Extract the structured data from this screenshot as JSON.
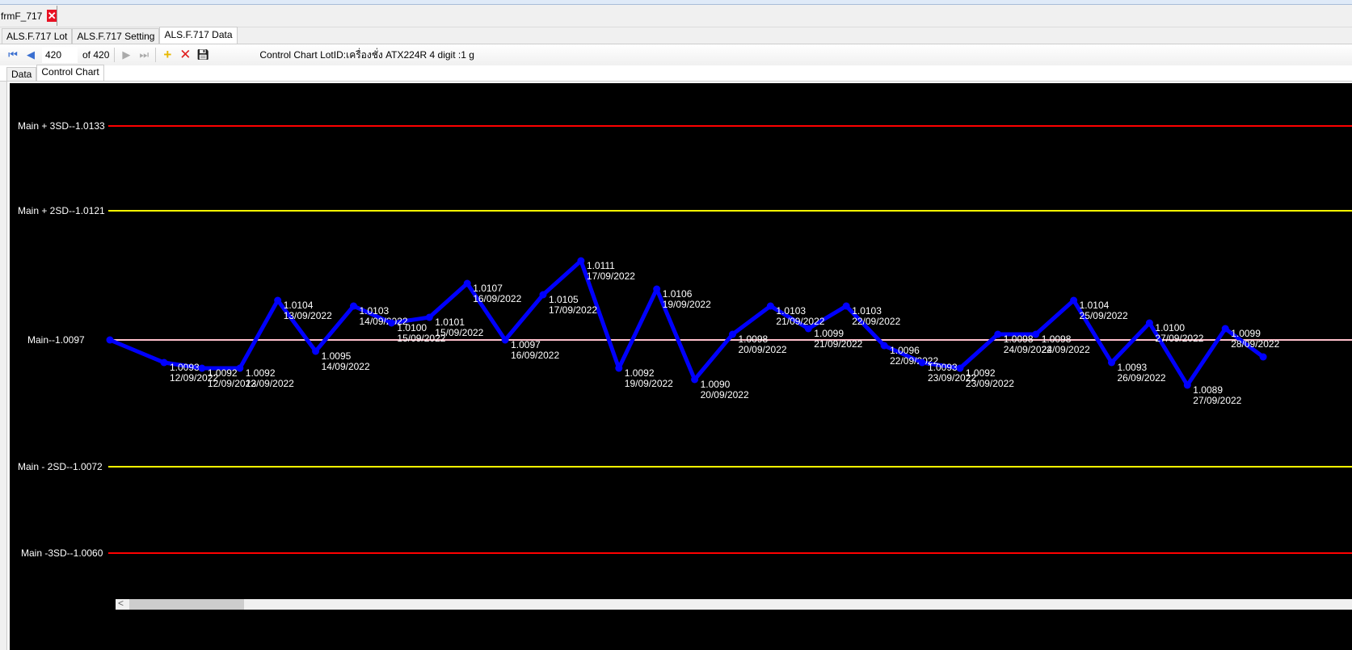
{
  "window": {
    "doc_tab": "frmF_717"
  },
  "tabs": [
    {
      "label": "ALS.F.717 Lot"
    },
    {
      "label": "ALS.F.717 Setting"
    },
    {
      "label": "ALS.F.717 Data"
    }
  ],
  "toolbar": {
    "position": "420",
    "of_label": "of 420",
    "title": "Control Chart LotID:เครื่องชั่ง  ATX224R 4 digit :1 g"
  },
  "subtabs": [
    {
      "label": "Data"
    },
    {
      "label": "Control Chart"
    }
  ],
  "chart_data": {
    "type": "line",
    "reference_lines": [
      {
        "label": "Main + 3SD--1.0133",
        "value": 1.0133,
        "color": "#ff0000"
      },
      {
        "label": "Main + 2SD--1.0121",
        "value": 1.0121,
        "color": "#ffff00"
      },
      {
        "label": "Main--1.0097",
        "value": 1.0097,
        "color": "#ffc0cb"
      },
      {
        "label": "Main - 2SD--1.0072",
        "value": 1.0072,
        "color": "#ffff00"
      },
      {
        "label": "Main -3SD--1.0060",
        "value": 1.006,
        "color": "#ff0000"
      }
    ],
    "series": [
      {
        "name": "values",
        "color": "#0000ff",
        "points": [
          {
            "v": 1.0097,
            "vl": "",
            "d": ""
          },
          {
            "v": 1.0093,
            "vl": "1.0093",
            "d": "12/09/2022"
          },
          {
            "v": 1.0092,
            "vl": "1.0092",
            "d": "12/09/2022"
          },
          {
            "v": 1.0092,
            "vl": "1.0092",
            "d": "13/09/2022"
          },
          {
            "v": 1.0104,
            "vl": "1.0104",
            "d": "13/09/2022"
          },
          {
            "v": 1.0095,
            "vl": "1.0095",
            "d": "14/09/2022"
          },
          {
            "v": 1.0103,
            "vl": "1.0103",
            "d": "14/09/2022"
          },
          {
            "v": 1.01,
            "vl": "1.0100",
            "d": "15/09/2022"
          },
          {
            "v": 1.0101,
            "vl": "1.0101",
            "d": "15/09/2022"
          },
          {
            "v": 1.0107,
            "vl": "1.0107",
            "d": "16/09/2022"
          },
          {
            "v": 1.0097,
            "vl": "1.0097",
            "d": "16/09/2022"
          },
          {
            "v": 1.0105,
            "vl": "1.0105",
            "d": "17/09/2022"
          },
          {
            "v": 1.0111,
            "vl": "1.0111",
            "d": "17/09/2022"
          },
          {
            "v": 1.0092,
            "vl": "1.0092",
            "d": "19/09/2022"
          },
          {
            "v": 1.0106,
            "vl": "1.0106",
            "d": "19/09/2022"
          },
          {
            "v": 1.009,
            "vl": "1.0090",
            "d": "20/09/2022"
          },
          {
            "v": 1.0098,
            "vl": "1.0098",
            "d": "20/09/2022"
          },
          {
            "v": 1.0103,
            "vl": "1.0103",
            "d": "21/09/2022"
          },
          {
            "v": 1.0099,
            "vl": "1.0099",
            "d": "21/09/2022"
          },
          {
            "v": 1.0103,
            "vl": "1.0103",
            "d": "22/09/2022"
          },
          {
            "v": 1.0096,
            "vl": "1.0096",
            "d": "22/09/2022"
          },
          {
            "v": 1.0093,
            "vl": "1.0093",
            "d": "23/09/2022"
          },
          {
            "v": 1.0092,
            "vl": "1.0092",
            "d": "23/09/2022"
          },
          {
            "v": 1.0098,
            "vl": "1.0098",
            "d": "24/09/2022"
          },
          {
            "v": 1.0098,
            "vl": "1.0098",
            "d": "24/09/2022"
          },
          {
            "v": 1.0104,
            "vl": "1.0104",
            "d": "25/09/2022"
          },
          {
            "v": 1.0093,
            "vl": "1.0093",
            "d": "26/09/2022"
          },
          {
            "v": 1.01,
            "vl": "1.0100",
            "d": "27/09/2022"
          },
          {
            "v": 1.0089,
            "vl": "1.0089",
            "d": "27/09/2022"
          },
          {
            "v": 1.0099,
            "vl": "1.0099",
            "d": "28/09/2022"
          },
          {
            "v": 1.0094,
            "vl": "",
            "d": ""
          }
        ]
      }
    ]
  }
}
